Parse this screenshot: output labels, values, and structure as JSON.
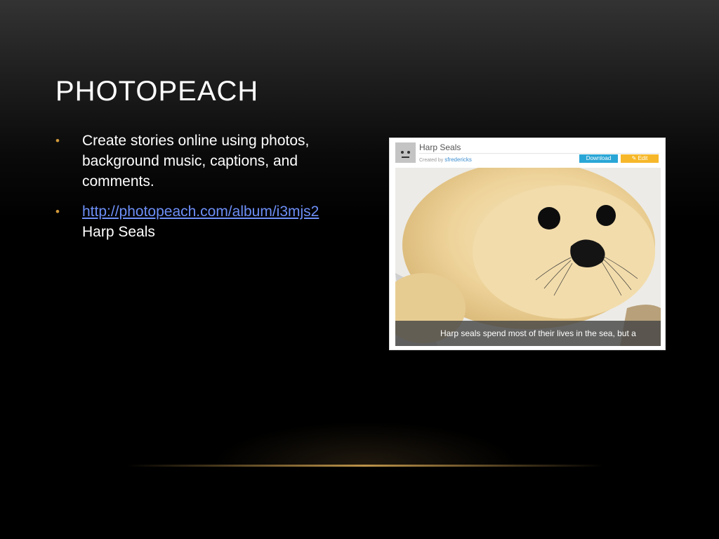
{
  "slide": {
    "title": "PHOTOPEACH",
    "bullets": [
      {
        "text": "Create stories online using photos, background music, captions, and comments."
      },
      {
        "link": "http://photopeach.com/album/i3mjs2",
        "text": "Harp Seals"
      }
    ]
  },
  "embedded_screenshot": {
    "album_title": "Harp Seals",
    "created_by_label": "Created by",
    "created_by_user": "sfredericks",
    "download_label": "Download",
    "edit_label": "Edit",
    "caption": "Harp seals spend most of their lives in the sea, but a"
  },
  "colors": {
    "bullet_accent": "#d39a3b",
    "link": "#6d8ff7",
    "download_button": "#2aa6d6",
    "edit_button": "#f6b82a"
  }
}
